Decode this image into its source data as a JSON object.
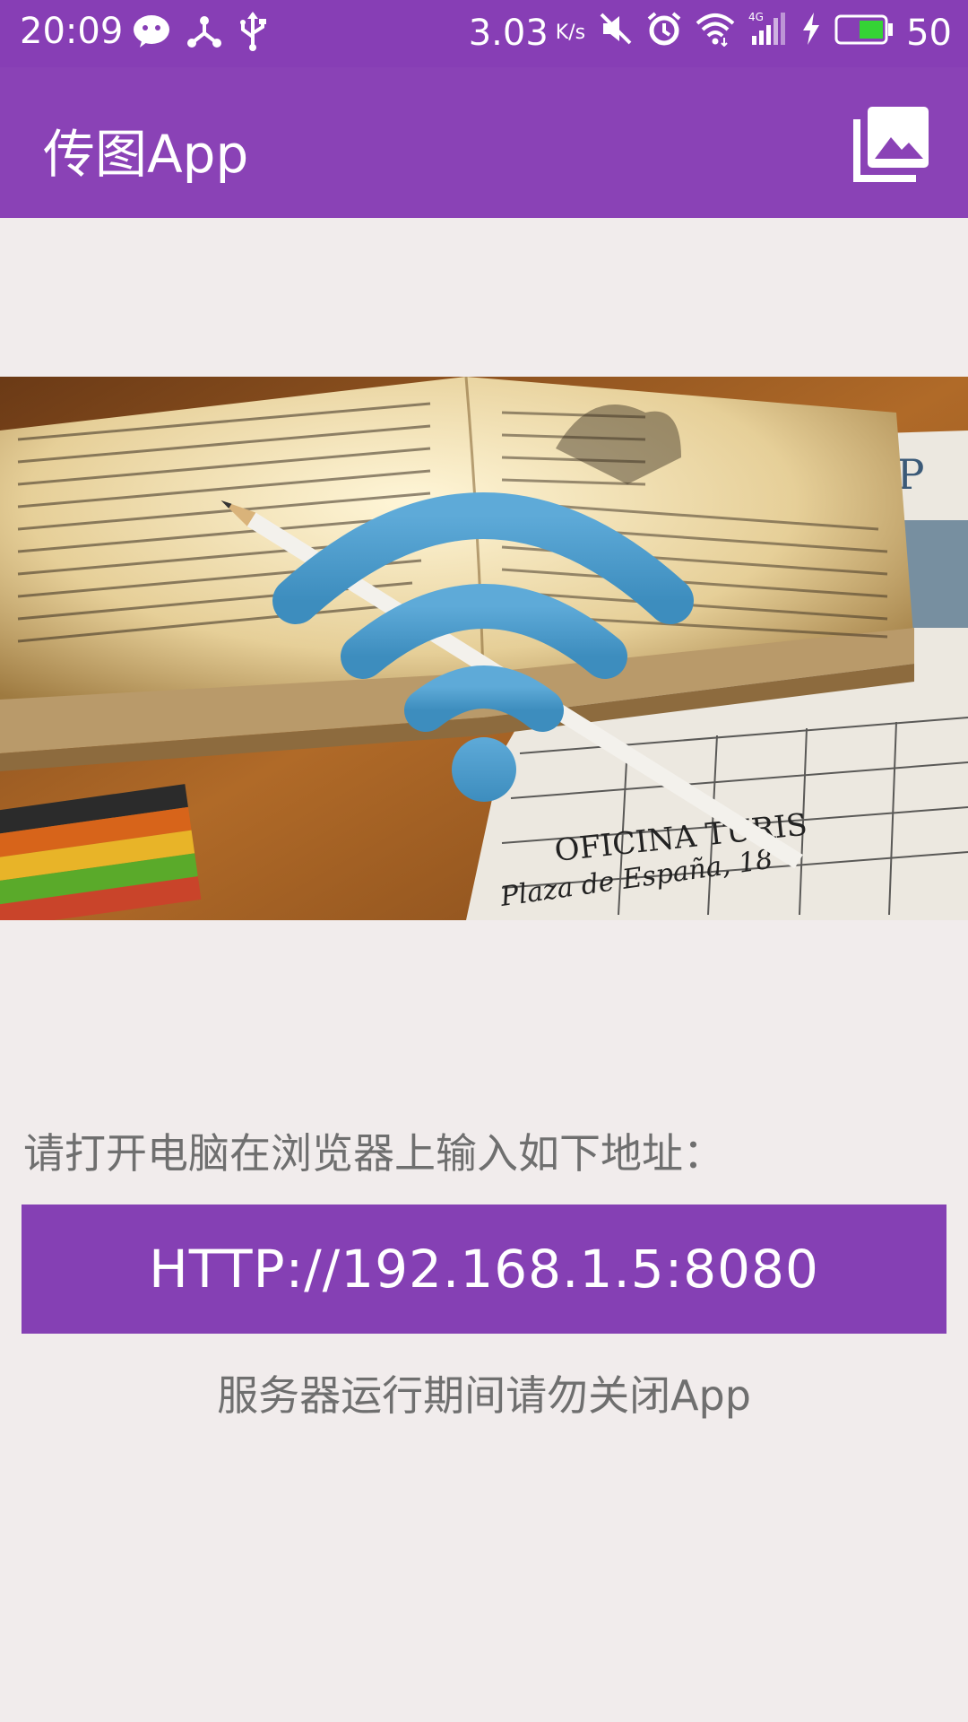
{
  "status_bar": {
    "time": "20:09",
    "speed": "3.03",
    "speed_unit": "K/s",
    "battery_level": "50",
    "icons": [
      "wechat-icon",
      "share-icon",
      "usb-icon",
      "mute-icon",
      "alarm-icon",
      "wifi-icon",
      "signal-4g-icon",
      "charging-icon",
      "battery-icon"
    ]
  },
  "app_bar": {
    "title": "传图App",
    "gallery_icon": "photo-library-icon"
  },
  "hero": {
    "image": "book-with-wifi-symbol",
    "wifi_color": "#4a9ccc"
  },
  "main": {
    "instruction": "请打开电脑在浏览器上输入如下地址：",
    "url": "HTTP://192.168.1.5:8080",
    "note": "服务器运行期间请勿关闭App"
  },
  "colors": {
    "primary": "#8a42b6",
    "status_bar": "#873eb5",
    "background": "#f1ecec",
    "text_secondary": "#6f6f6f"
  }
}
